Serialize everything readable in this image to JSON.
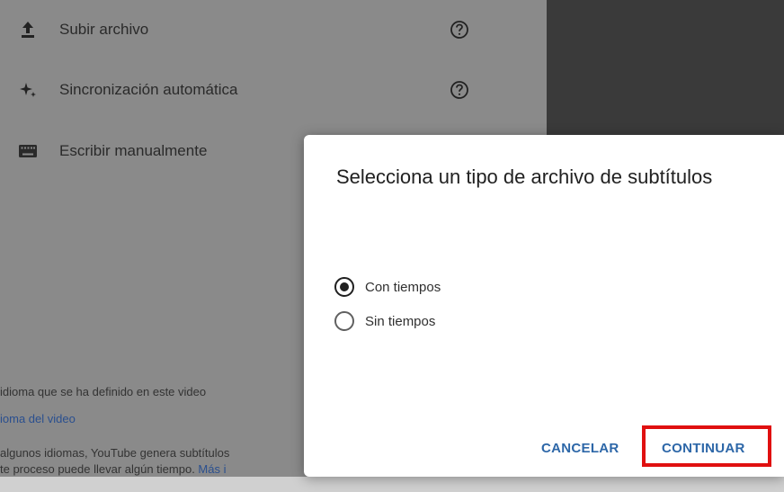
{
  "background": {
    "menu": [
      {
        "icon": "upload-icon",
        "label": "Subir archivo",
        "help": true
      },
      {
        "icon": "sparkle-icon",
        "label": "Sincronización automática",
        "help": true
      },
      {
        "icon": "keyboard-icon",
        "label": "Escribir manualmente",
        "help": false
      }
    ],
    "footer": {
      "line1": "idioma que se ha definido en este video",
      "link1": "ioma del video",
      "line3": "algunos idiomas, YouTube genera subtítulos",
      "line4": "te proceso puede llevar algún tiempo. ",
      "link2": "Más i"
    }
  },
  "dialog": {
    "title": "Selecciona un tipo de archivo de subtítulos",
    "options": [
      {
        "label": "Con tiempos",
        "selected": true
      },
      {
        "label": "Sin tiempos",
        "selected": false
      }
    ],
    "cancel_label": "CANCELAR",
    "continue_label": "CONTINUAR"
  },
  "colors": {
    "accent": "#2d67a8",
    "highlight": "#e01010"
  }
}
